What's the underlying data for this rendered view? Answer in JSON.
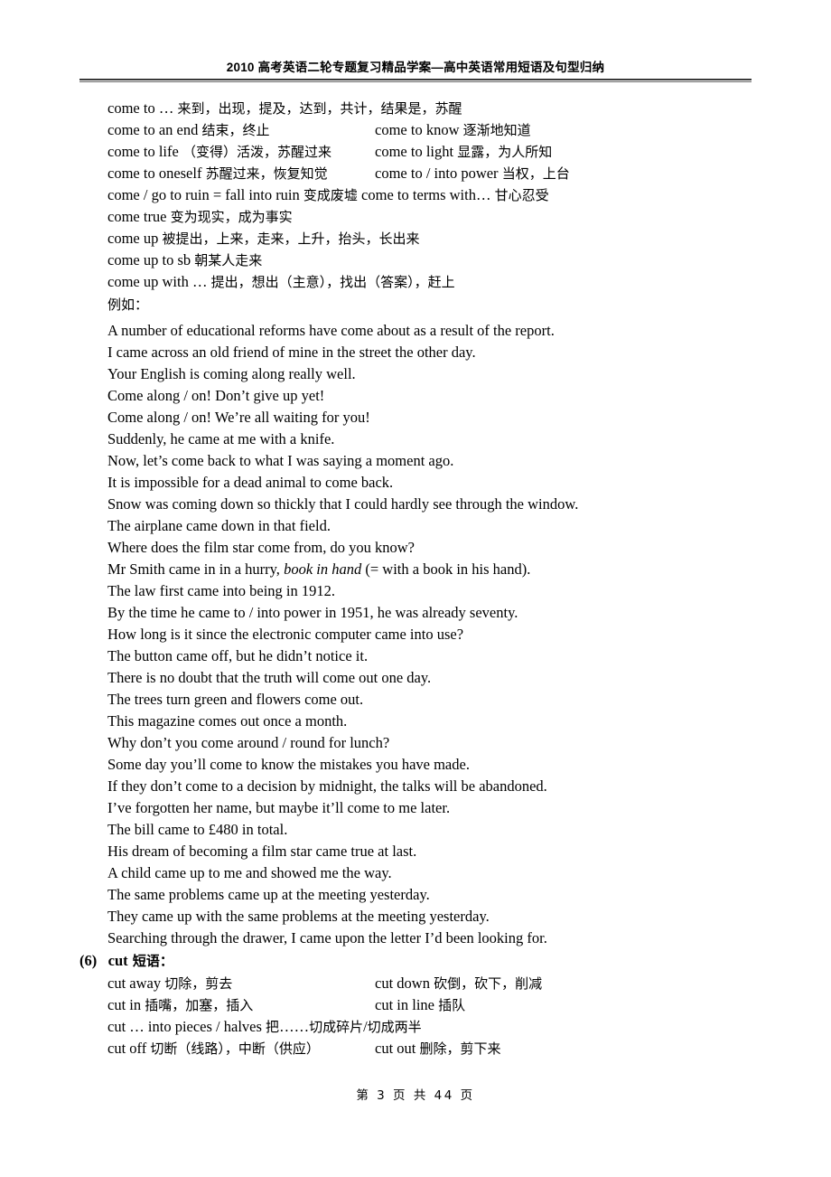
{
  "header": {
    "title": "2010 高考英语二轮专题复习精品学案—高中英语常用短语及句型归纳"
  },
  "phrases_come": [
    {
      "col1": "come to …  来到，出现，提及，达到，共计，结果是，苏醒",
      "col2": ""
    },
    {
      "col1": "come to an end  结束，终止",
      "col2": "come to know  逐渐地知道"
    },
    {
      "col1": "come to life    （变得）活泼，苏醒过来",
      "col2": "come to light  显露，为人所知"
    },
    {
      "col1": "come to oneself  苏醒过来，恢复知觉",
      "col2": "come to / into power  当权，上台"
    },
    {
      "col1": "come / go to ruin = fall into ruin  变成废墟 come to terms with…  甘心忍受",
      "col2": "",
      "wide": true
    },
    {
      "col1": "come true  变为现实，成为事实",
      "col2": ""
    },
    {
      "col1": "come up  被提出，上来，走来，上升，抬头，长出来",
      "col2": ""
    },
    {
      "col1": "come up to sb  朝某人走来",
      "col2": ""
    },
    {
      "col1": "come up with …  提出，想出（主意），找出（答案），赶上",
      "col2": ""
    }
  ],
  "example_label": "例如：",
  "examples_come": [
    "A number of educational reforms have come about as a result of the report.",
    "I came across an old friend of mine in the street the other day.",
    "Your English is coming along really well.",
    "Come along / on! Don’t give up yet!",
    "Come along / on! We’re all waiting for you!",
    "Suddenly, he came at me with a knife.",
    "Now, let’s come back to what I was saying a moment ago.",
    "It is impossible for a dead animal to come back.",
    "Snow was coming down so thickly that I could hardly see through the window.",
    "The airplane came down in that field.",
    "Where does the film star come from, do you know?",
    "The law first came into being in 1912.",
    "By the time he came to / into power in 1951, he was already seventy.",
    "How long is it since the electronic computer came into use?",
    "The button came off, but he didn’t notice it.",
    "There is no doubt that the truth will come out one day.",
    "The trees turn green and flowers come out.",
    "This magazine comes out once a month.",
    "Why don’t you come around / round for lunch?",
    "Some day you’ll come to know the mistakes you have made.",
    "If they don’t come to a decision by midnight, the talks will be abandoned.",
    "I’ve forgotten her name, but maybe it’ll come to me later.",
    "The bill came to £480 in total.",
    "His dream of becoming a film star came true at last.",
    "A child came up to me and showed me the way.",
    "The same problems came up at the meeting yesterday.",
    "They came up with the same problems at the meeting yesterday.",
    "Searching through the drawer, I came upon the letter I’d been looking for."
  ],
  "example_italic": {
    "index": 11,
    "before": "Mr Smith came in in a hurry, ",
    "italic": "book in hand",
    "after": " (= with a book in his hand)."
  },
  "section_cut": {
    "number": "(6)",
    "title_latin": "cut",
    "title_cjk": " 短语："
  },
  "phrases_cut": [
    {
      "col1": "cut away  切除，剪去",
      "col2": "cut down  砍倒，砍下，削减"
    },
    {
      "col1": "cut in  插嘴，加塞，插入",
      "col2": "cut in line  插队"
    },
    {
      "col1": "cut … into pieces / halves  把……切成碎片/切成两半",
      "col2": ""
    },
    {
      "col1": "cut off  切断（线路），中断（供应）",
      "col2": "cut out  删除，剪下来"
    }
  ],
  "footer": {
    "text": "第 3 页 共 44 页"
  }
}
